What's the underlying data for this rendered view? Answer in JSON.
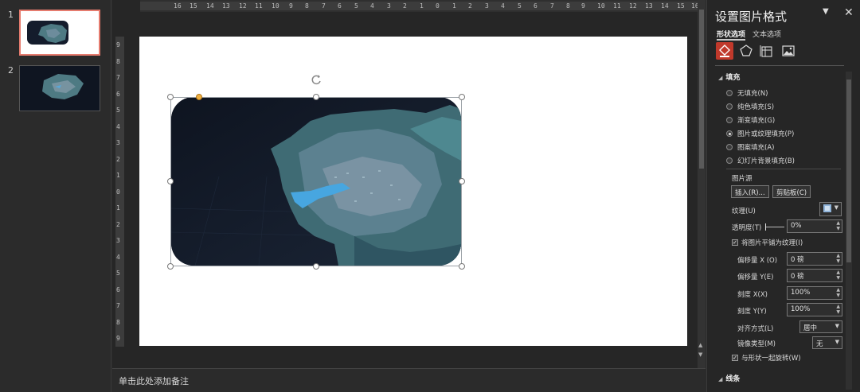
{
  "thumbnails": [
    {
      "num": "1"
    },
    {
      "num": "2"
    }
  ],
  "ruler": {
    "h_ticks": [
      "16",
      "15",
      "14",
      "13",
      "12",
      "11",
      "10",
      "9",
      "8",
      "7",
      "6",
      "5",
      "4",
      "3",
      "2",
      "1",
      "0",
      "1",
      "2",
      "3",
      "4",
      "5",
      "6",
      "7",
      "8",
      "9",
      "10",
      "11",
      "12",
      "13",
      "14",
      "15",
      "16"
    ],
    "v_ticks": [
      "9",
      "8",
      "7",
      "6",
      "5",
      "4",
      "3",
      "2",
      "1",
      "0",
      "1",
      "2",
      "3",
      "4",
      "5",
      "6",
      "7",
      "8",
      "9"
    ]
  },
  "notes": {
    "placeholder": "单击此处添加备注"
  },
  "pane": {
    "title": "设置图片格式",
    "tab_shape": "形状选项",
    "tab_text": "文本选项",
    "fill_section": "填充",
    "fill_options": [
      {
        "label": "无填充(N)",
        "selected": false
      },
      {
        "label": "纯色填充(S)",
        "selected": false
      },
      {
        "label": "渐变填充(G)",
        "selected": false
      },
      {
        "label": "图片或纹理填充(P)",
        "selected": true
      },
      {
        "label": "图案填充(A)",
        "selected": false
      },
      {
        "label": "幻灯片背景填充(B)",
        "selected": false
      }
    ],
    "picture_source": "图片源",
    "insert_btn": "插入(R)...",
    "clipboard_btn": "剪贴板(C)",
    "texture_label": "纹理(U)",
    "transparency_label": "透明度(T)",
    "transparency_value": "0%",
    "tile_label": "将图片平铺为纹理(I)",
    "offset_x_label": "偏移量 X (O)",
    "offset_x_value": "0 磅",
    "offset_y_label": "偏移量 Y(E)",
    "offset_y_value": "0 磅",
    "scale_x_label": "刻度 X(X)",
    "scale_x_value": "100%",
    "scale_y_label": "刻度 Y(Y)",
    "scale_y_value": "100%",
    "align_label": "对齐方式(L)",
    "align_value": "居中",
    "mirror_label": "镜像类型(M)",
    "mirror_value": "无",
    "rotate_label": "与形状一起旋转(W)",
    "line_section": "线条"
  },
  "colors": {
    "accent": "#c0392b",
    "selection": "#e57b6e"
  }
}
